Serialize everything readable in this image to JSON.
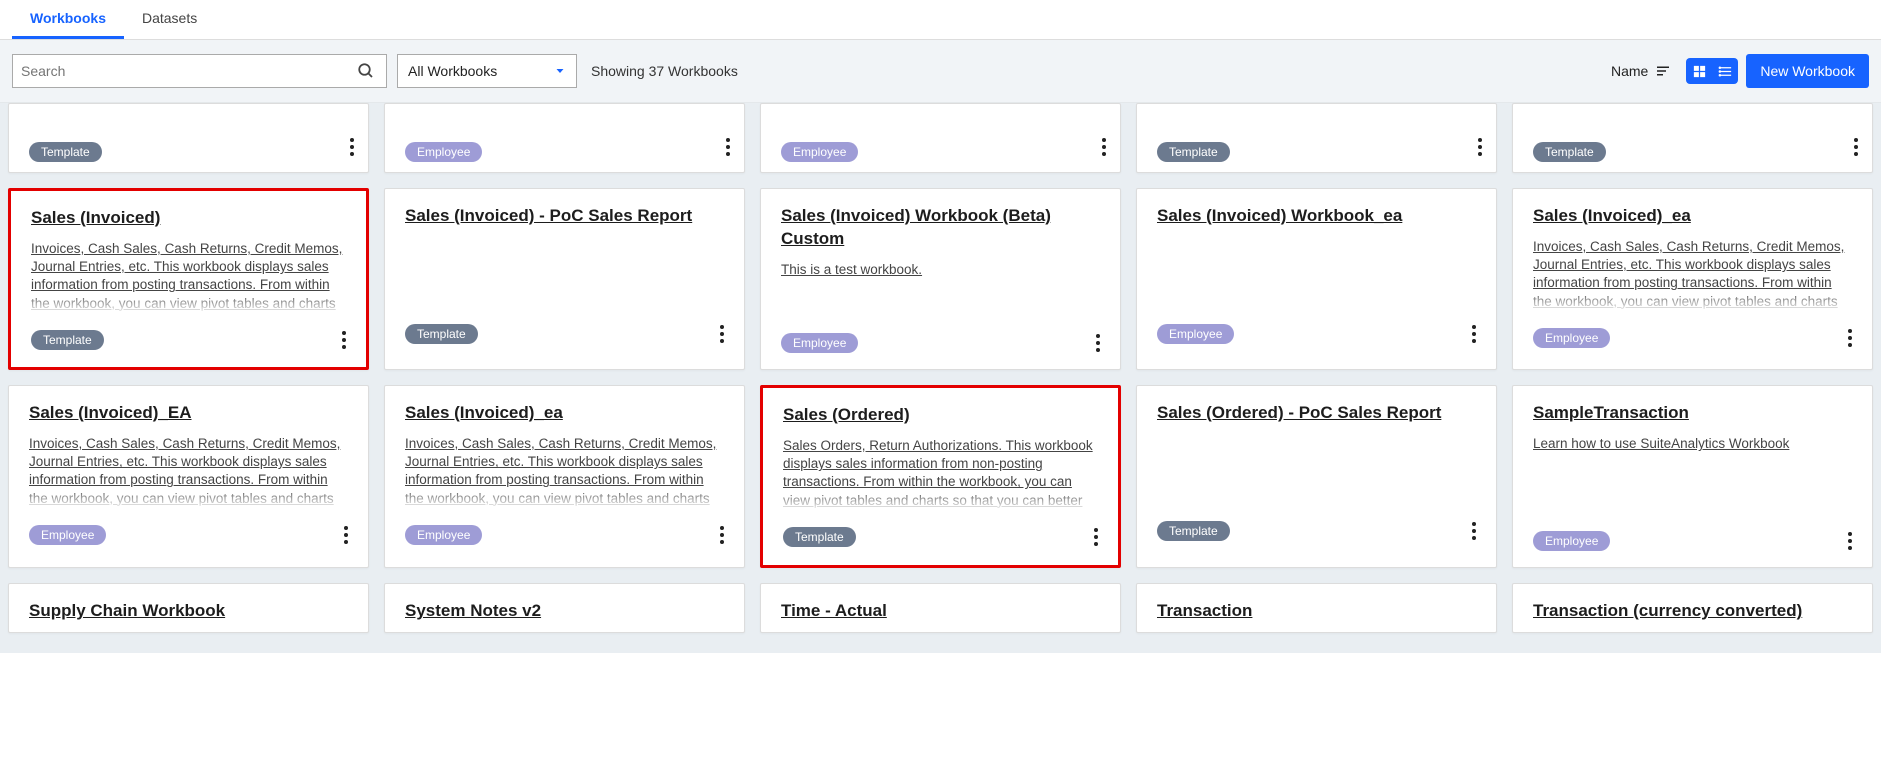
{
  "tabs": [
    "Workbooks",
    "Datasets"
  ],
  "activeTab": 0,
  "search": {
    "placeholder": "Search"
  },
  "filter": {
    "label": "All Workbooks"
  },
  "countText": "Showing 37 Workbooks",
  "sort": {
    "label": "Name"
  },
  "newBtn": "New Workbook",
  "badges": {
    "template": "Template",
    "employee": "Employee"
  },
  "row0": [
    {
      "badge": "template"
    },
    {
      "badge": "employee"
    },
    {
      "badge": "employee"
    },
    {
      "badge": "template"
    },
    {
      "badge": "template"
    }
  ],
  "row1": [
    {
      "title": "Sales (Invoiced)",
      "desc": "Invoices, Cash Sales, Cash Returns, Credit Memos, Journal Entries, etc. This workbook displays sales information from posting transactions. From within the workbook, you can view pivot tables and charts so that you",
      "badge": "template",
      "highlight": true
    },
    {
      "title": "Sales (Invoiced) - PoC Sales Report",
      "desc": "",
      "badge": "template"
    },
    {
      "title": "Sales (Invoiced) Workbook (Beta) Custom",
      "desc": "This is a test workbook.",
      "badge": "employee"
    },
    {
      "title": "Sales (Invoiced) Workbook_ea",
      "desc": "",
      "badge": "employee"
    },
    {
      "title": "Sales (Invoiced)_ea",
      "desc": "Invoices, Cash Sales, Cash Returns, Credit Memos, Journal Entries, etc. This workbook displays sales information from posting transactions. From within the workbook, you can view pivot tables and charts so that you",
      "badge": "employee"
    }
  ],
  "row2": [
    {
      "title": "Sales (Invoiced)_EA",
      "desc": "Invoices, Cash Sales, Cash Returns, Credit Memos, Journal Entries, etc. This workbook displays sales information from posting transactions. From within the workbook, you can view pivot tables and charts so that you",
      "badge": "employee"
    },
    {
      "title": "Sales (Invoiced)_ea",
      "desc": "Invoices, Cash Sales, Cash Returns, Credit Memos, Journal Entries, etc. This workbook displays sales information from posting transactions. From within the workbook, you can view pivot tables and charts so that you",
      "badge": "employee"
    },
    {
      "title": "Sales (Ordered)",
      "desc": "Sales Orders, Return Authorizations. This workbook displays sales information from non-posting transactions. From within the workbook, you can view pivot tables and charts so that you can better monitor these",
      "badge": "template",
      "highlight": true
    },
    {
      "title": "Sales (Ordered) - PoC Sales Report",
      "desc": "",
      "badge": "template"
    },
    {
      "title": "SampleTransaction",
      "desc": "Learn how to use SuiteAnalytics Workbook",
      "badge": "employee"
    }
  ],
  "row3": [
    {
      "title": "Supply Chain Workbook"
    },
    {
      "title": "System Notes v2"
    },
    {
      "title": "Time - Actual"
    },
    {
      "title": "Transaction"
    },
    {
      "title": "Transaction (currency converted)"
    }
  ]
}
